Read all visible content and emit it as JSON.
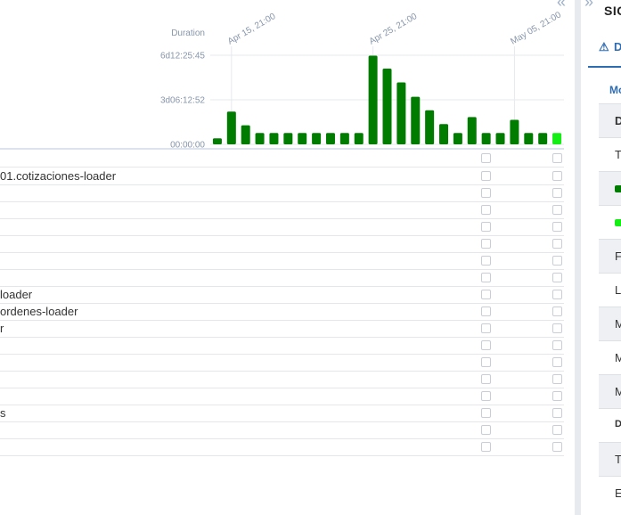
{
  "chart_data": {
    "type": "bar",
    "ylabel": "Duration",
    "yticks": [
      "6d12:25:45",
      "3d06:12:52",
      "00:00:00"
    ],
    "yvalues_seconds": [
      562545,
      281572,
      0
    ],
    "ylim": [
      0,
      562545
    ],
    "xticks": [
      "Apr 15, 21:00",
      "Apr 25, 21:00",
      "May 05, 21:00"
    ],
    "xtick_bar_index": [
      1,
      11,
      21
    ],
    "bar_colors": [
      "#007d00",
      "#007d00",
      "#007d00",
      "#007d00",
      "#007d00",
      "#007d00",
      "#007d00",
      "#007d00",
      "#007d00",
      "#007d00",
      "#007d00",
      "#007d00",
      "#007d00",
      "#007d00",
      "#007d00",
      "#007d00",
      "#007d00",
      "#007d00",
      "#007d00",
      "#007d00",
      "#007d00",
      "#007d00",
      "#007d00",
      "#007d00",
      "#15ee15"
    ],
    "values": [
      38000,
      207000,
      120000,
      72000,
      72000,
      72000,
      72000,
      72000,
      72000,
      72000,
      72000,
      560000,
      478000,
      391000,
      300000,
      215000,
      128000,
      72000,
      172000,
      72000,
      72000,
      155000,
      72000,
      72000,
      72000
    ]
  },
  "collapse_icon": "double-chevron-right-icon",
  "rows": [
    {
      "label": "01.cotizaciones-loader"
    },
    {
      "label": ""
    },
    {
      "label": ""
    },
    {
      "label": ""
    },
    {
      "label": ""
    },
    {
      "label": ""
    },
    {
      "label": ""
    },
    {
      "label": "loader"
    },
    {
      "label": "ordenes-loader"
    },
    {
      "label": "r"
    },
    {
      "label": ""
    },
    {
      "label": ""
    },
    {
      "label": ""
    },
    {
      "label": ""
    },
    {
      "label": "s"
    },
    {
      "label": ""
    },
    {
      "label": ""
    }
  ],
  "side": {
    "title": "SIC",
    "tab_label": "D",
    "sub_label": "Mo",
    "rows": [
      {
        "text": "D",
        "shade": true,
        "bold": true
      },
      {
        "text": "T",
        "shade": false
      },
      {
        "swatch": "#007d00",
        "shade": true
      },
      {
        "swatch": "#15ee15",
        "shade": false
      },
      {
        "text": "F",
        "shade": true
      },
      {
        "text": "L",
        "shade": false
      },
      {
        "text": "M",
        "shade": true
      },
      {
        "text": "M",
        "shade": false
      },
      {
        "text": "M",
        "shade": true
      },
      {
        "text": "D",
        "shade": false,
        "bold": true,
        "small": true
      },
      {
        "text": "T",
        "shade": true
      },
      {
        "text": "E",
        "shade": false
      }
    ]
  }
}
